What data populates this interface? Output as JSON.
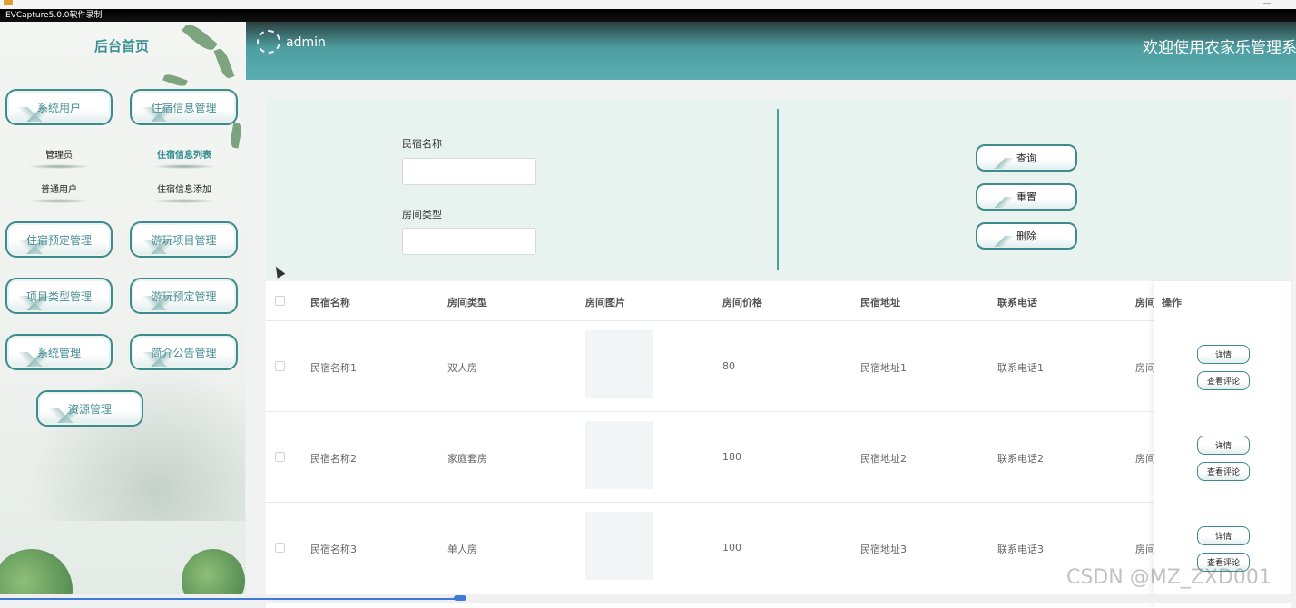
{
  "recorder": {
    "label": "EVCapture5.0.0软件录制"
  },
  "sidebar": {
    "title": "后台首页",
    "menus": [
      {
        "label": "系统用户",
        "subs": [
          {
            "label": "管理员",
            "active": false
          },
          {
            "label": "普通用户",
            "active": false
          }
        ]
      },
      {
        "label": "住宿信息管理",
        "subs": [
          {
            "label": "住宿信息列表",
            "active": true
          },
          {
            "label": "住宿信息添加",
            "active": false
          }
        ]
      },
      {
        "label": "住宿预定管理"
      },
      {
        "label": "游玩项目管理"
      },
      {
        "label": "项目类型管理"
      },
      {
        "label": "游玩预定管理"
      },
      {
        "label": "系统管理"
      },
      {
        "label": "简介公告管理"
      },
      {
        "label": "资源管理"
      }
    ]
  },
  "header": {
    "user": "admin",
    "welcome": "欢迎使用农家乐管理系"
  },
  "search": {
    "field1_label": "民宿名称",
    "field1_value": "",
    "field2_label": "房间类型",
    "field2_value": "",
    "query_label": "查询",
    "reset_label": "重置",
    "delete_label": "删除"
  },
  "table": {
    "columns": [
      "民宿名称",
      "房间类型",
      "房间图片",
      "房间价格",
      "民宿地址",
      "联系电话",
      "房间",
      "操作"
    ],
    "rows": [
      {
        "name": "民宿名称1",
        "type": "双人房",
        "price": "80",
        "address": "民宿地址1",
        "phone": "联系电话1",
        "room": "房间"
      },
      {
        "name": "民宿名称2",
        "type": "家庭套房",
        "price": "180",
        "address": "民宿地址2",
        "phone": "联系电话2",
        "room": "房间"
      },
      {
        "name": "民宿名称3",
        "type": "单人房",
        "price": "100",
        "address": "民宿地址3",
        "phone": "联系电话3",
        "room": "房间"
      }
    ],
    "detail_label": "详情",
    "comments_label": "查看评论"
  },
  "watermark": "CSDN @MZ_ZXD001",
  "colors": {
    "accent": "#4e9ea1",
    "title": "#3e8f95",
    "border": "#3f8a8c"
  }
}
